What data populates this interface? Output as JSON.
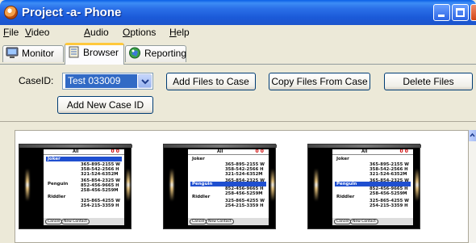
{
  "window": {
    "title": "Project -a- Phone",
    "minimize": "minimize",
    "maximize": "maximize",
    "close": "close"
  },
  "menubar": [
    {
      "mnemonic": "F",
      "rest": "ile"
    },
    {
      "mnemonic": "V",
      "rest": "ideo"
    },
    {
      "mnemonic": "A",
      "rest": "udio"
    },
    {
      "mnemonic": "O",
      "rest": "ptions"
    },
    {
      "mnemonic": "H",
      "rest": "elp"
    }
  ],
  "tabs": [
    {
      "label": "Monitor",
      "icon": "monitor-icon",
      "active": false
    },
    {
      "label": "Browser",
      "icon": "notebook-icon",
      "active": true
    },
    {
      "label": "Reporting",
      "icon": "reporting-icon",
      "active": false
    }
  ],
  "controls": {
    "caseid_label": "CaseID:",
    "caseid_value": "Test 033009",
    "add_files_label": "Add Files to Case",
    "copy_files_label": "Copy Files From Case",
    "delete_files_label": "Delete Files",
    "add_case_label": "Add New Case ID"
  },
  "thumbnails": [
    {
      "selected": null
    },
    {
      "selected": "Penguin"
    },
    {
      "selected": "Penguin"
    }
  ],
  "phone_screen": {
    "filter": "All",
    "counter": "0 0",
    "contacts": [
      {
        "name": "Joker",
        "numbers": [
          "365-895-2155 W",
          "358-542-2566 H",
          "321-524-6352M"
        ]
      },
      {
        "name": "Penguin",
        "numbers": [
          "365-854-2325 W",
          "852-456-9665 H",
          "258-456-5259M"
        ]
      },
      {
        "name": "Riddler",
        "numbers": [
          "325-865-4255 W",
          "254-215-3359 H"
        ]
      }
    ],
    "cancel_label": "Cancel",
    "new_contact_label": "New Contact"
  },
  "colors": {
    "titlebar": "#2a6fe8",
    "selection": "#316ac5",
    "active_tab_accent": "#ffc83c"
  }
}
